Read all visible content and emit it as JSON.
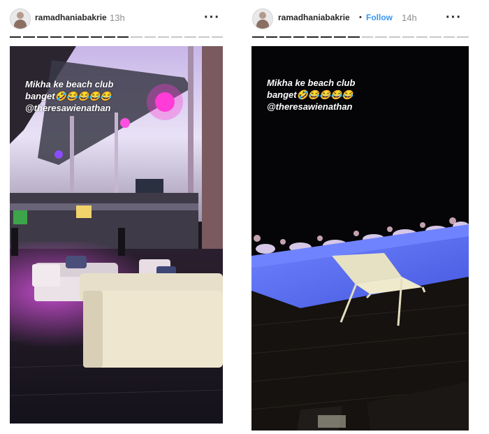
{
  "left_story": {
    "username": "ramadhaniabakrie",
    "time": "13h",
    "more_icon": "more-icon",
    "caption_line1": "Mikha ke beach club",
    "caption_line2": "banget🤣😂😂😂😂",
    "caption_line3": "@theresawienathan",
    "progress_segments_total": 16,
    "progress_segments_done": 9
  },
  "right_story": {
    "username": "ramadhaniabakrie",
    "separator": "•",
    "follow_label": "Follow",
    "time": "14h",
    "more_icon": "more-icon",
    "caption_line1": "Mikha ke beach club",
    "caption_line2": "banget🤣😂😂😂😂",
    "caption_line3": "@theresawienathan",
    "progress_segments_total": 16,
    "progress_segments_done": 8
  },
  "colors": {
    "follow": "#3897f0",
    "text": "#262626",
    "time": "#8e8e8e",
    "progress_done": "#262626",
    "progress_todo": "#c7c7c7",
    "pool": "#4f63e8",
    "pink_light": "#ff3dd8"
  }
}
